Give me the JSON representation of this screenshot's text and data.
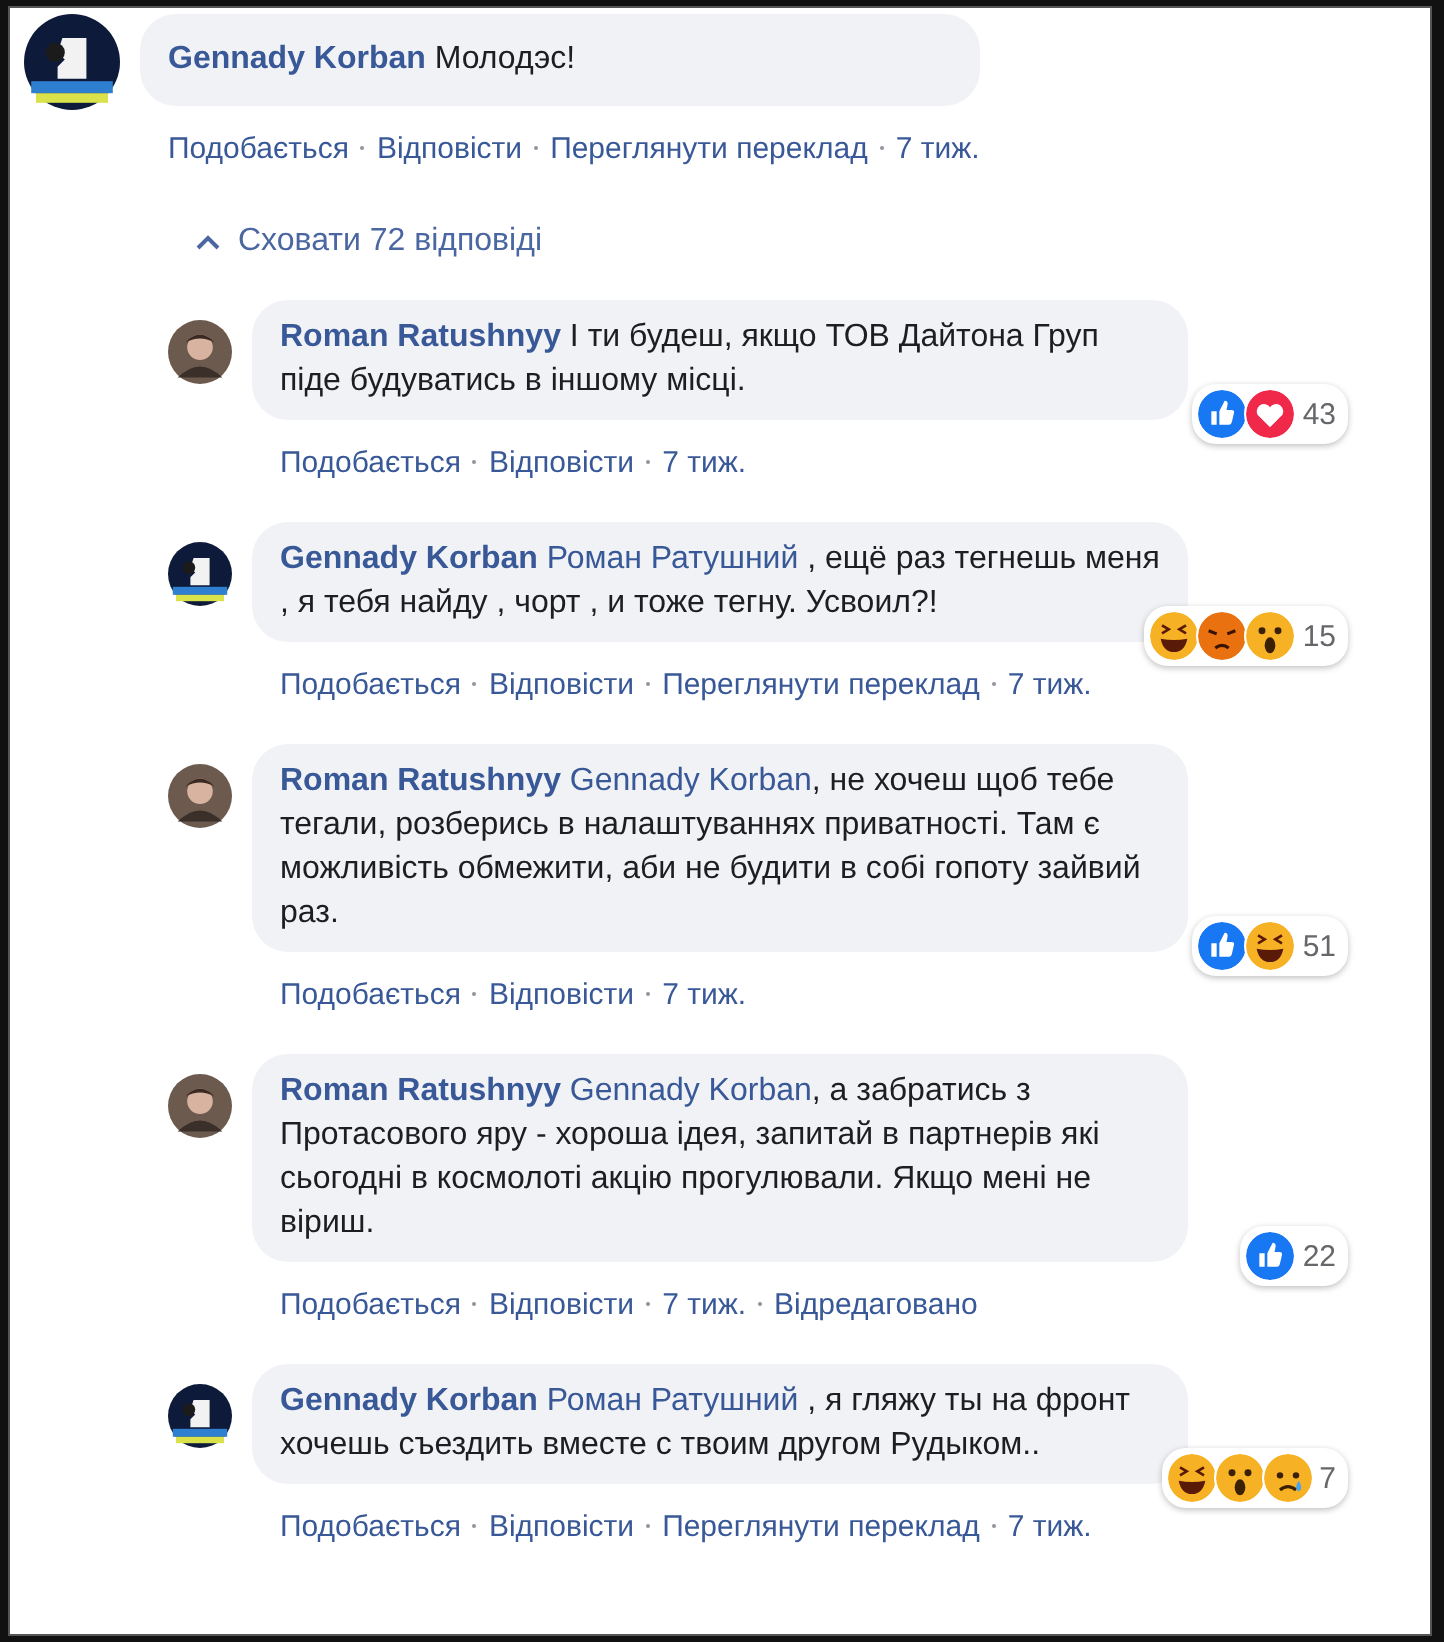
{
  "comment": {
    "author": "Gennady Korban",
    "avatar": {
      "kind": "dark"
    },
    "text": "Молодэс!",
    "actions": [
      "Подобається",
      "Відповісти",
      "Переглянути переклад",
      "7 тиж."
    ],
    "toggle": {
      "label": "Сховати 72 відповіді",
      "expanded": true
    },
    "replies": [
      {
        "author": "Roman Ratushnyy",
        "avatar": {
          "kind": "person"
        },
        "text": "І ти будеш, якщо ТОВ Дайтона Груп піде будуватись в іншому місці.",
        "actions": [
          "Подобається",
          "Відповісти",
          "7 тиж."
        ],
        "reactions": [
          {
            "kind": "like"
          },
          {
            "kind": "love"
          }
        ],
        "count": "43"
      },
      {
        "author": "Gennady Korban",
        "avatar": {
          "kind": "dark"
        },
        "mention": "Роман Ратушний",
        "text": " , ещё раз тегнешь меня , я тебя найду , чорт , и тоже тегну. Усвоил?!",
        "actions": [
          "Подобається",
          "Відповісти",
          "Переглянути переклад",
          "7 тиж."
        ],
        "reactions": [
          {
            "kind": "haha"
          },
          {
            "kind": "angry"
          },
          {
            "kind": "wow"
          }
        ],
        "count": "15"
      },
      {
        "author": "Roman Ratushnyy",
        "avatar": {
          "kind": "person"
        },
        "mention": "Gennady Korban",
        "text": ", не хочеш щоб тебе тегали, розберись в налаштуваннях приватності. Там є можливість обмежити, аби не будити в собі гопоту зайвий раз.",
        "actions": [
          "Подобається",
          "Відповісти",
          "7 тиж."
        ],
        "reactions": [
          {
            "kind": "like"
          },
          {
            "kind": "haha"
          }
        ],
        "count": "51"
      },
      {
        "author": "Roman Ratushnyy",
        "avatar": {
          "kind": "person"
        },
        "mention": "Gennady Korban",
        "text": ", а забратись з Протасового яру - хороша ідея, запитай в партнерів які сьогодні в космолоті акцію прогулювали. Якщо мені не віриш.",
        "actions": [
          "Подобається",
          "Відповісти",
          "7 тиж.",
          "Відредаговано"
        ],
        "reactions": [
          {
            "kind": "like"
          }
        ],
        "count": "22"
      },
      {
        "author": "Gennady Korban",
        "avatar": {
          "kind": "dark"
        },
        "mention": "Роман Ратушний",
        "text": " , я гляжу ты на фронт хочешь съездить вместе с твоим другом Рудыком..",
        "actions": [
          "Подобається",
          "Відповісти",
          "Переглянути переклад",
          "7 тиж."
        ],
        "reactions": [
          {
            "kind": "haha"
          },
          {
            "kind": "wow"
          },
          {
            "kind": "sad"
          }
        ],
        "count": "7"
      }
    ]
  }
}
